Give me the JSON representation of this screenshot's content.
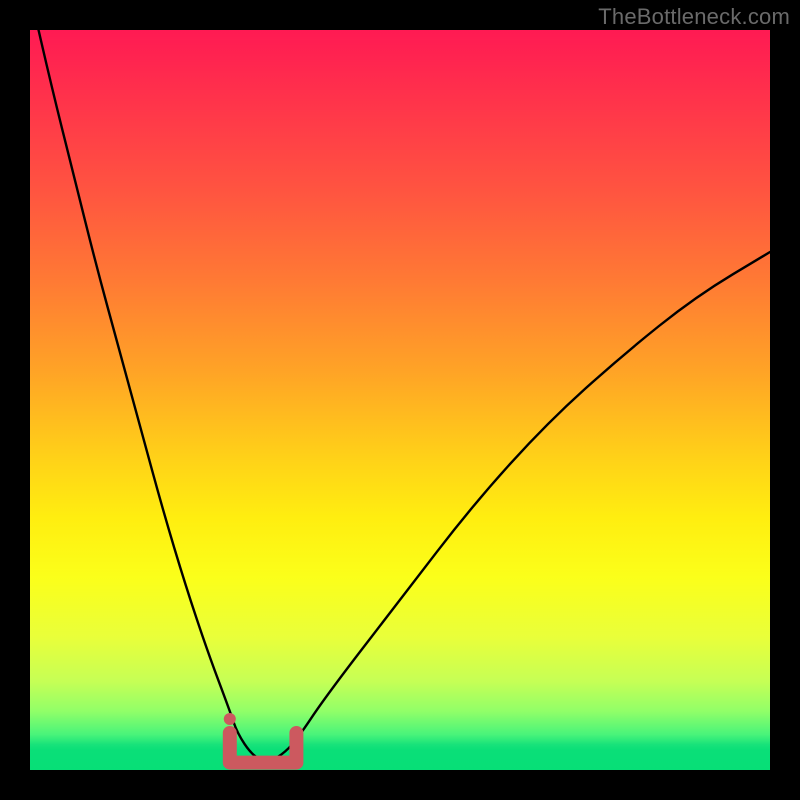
{
  "watermark": {
    "text": "TheBottleneck.com"
  },
  "colors": {
    "frame": "#000000",
    "curve_stroke": "#000000",
    "trough_marker": "#cc595f",
    "gradient_top": "#ff1a53",
    "gradient_mid": "#ffee10",
    "gradient_bottom": "#07df77"
  },
  "chart_data": {
    "type": "line",
    "title": "",
    "xlabel": "",
    "ylabel": "",
    "xlim": [
      0,
      100
    ],
    "ylim": [
      0,
      100
    ],
    "grid": false,
    "legend": false,
    "series": [
      {
        "name": "bottleneck-curve",
        "x": [
          0,
          3,
          6,
          9,
          12,
          15,
          18,
          21,
          24,
          27,
          28,
          30,
          32,
          34,
          36,
          40,
          50,
          60,
          70,
          80,
          90,
          100
        ],
        "values": [
          105,
          92,
          80,
          68,
          57,
          46,
          35,
          25,
          16,
          8,
          5,
          2,
          1,
          2,
          4,
          10,
          23,
          36,
          47,
          56,
          64,
          70
        ]
      }
    ],
    "annotations": [
      {
        "name": "trough-marker",
        "type": "marker",
        "x_range": [
          27,
          36
        ],
        "y": 1
      }
    ]
  }
}
